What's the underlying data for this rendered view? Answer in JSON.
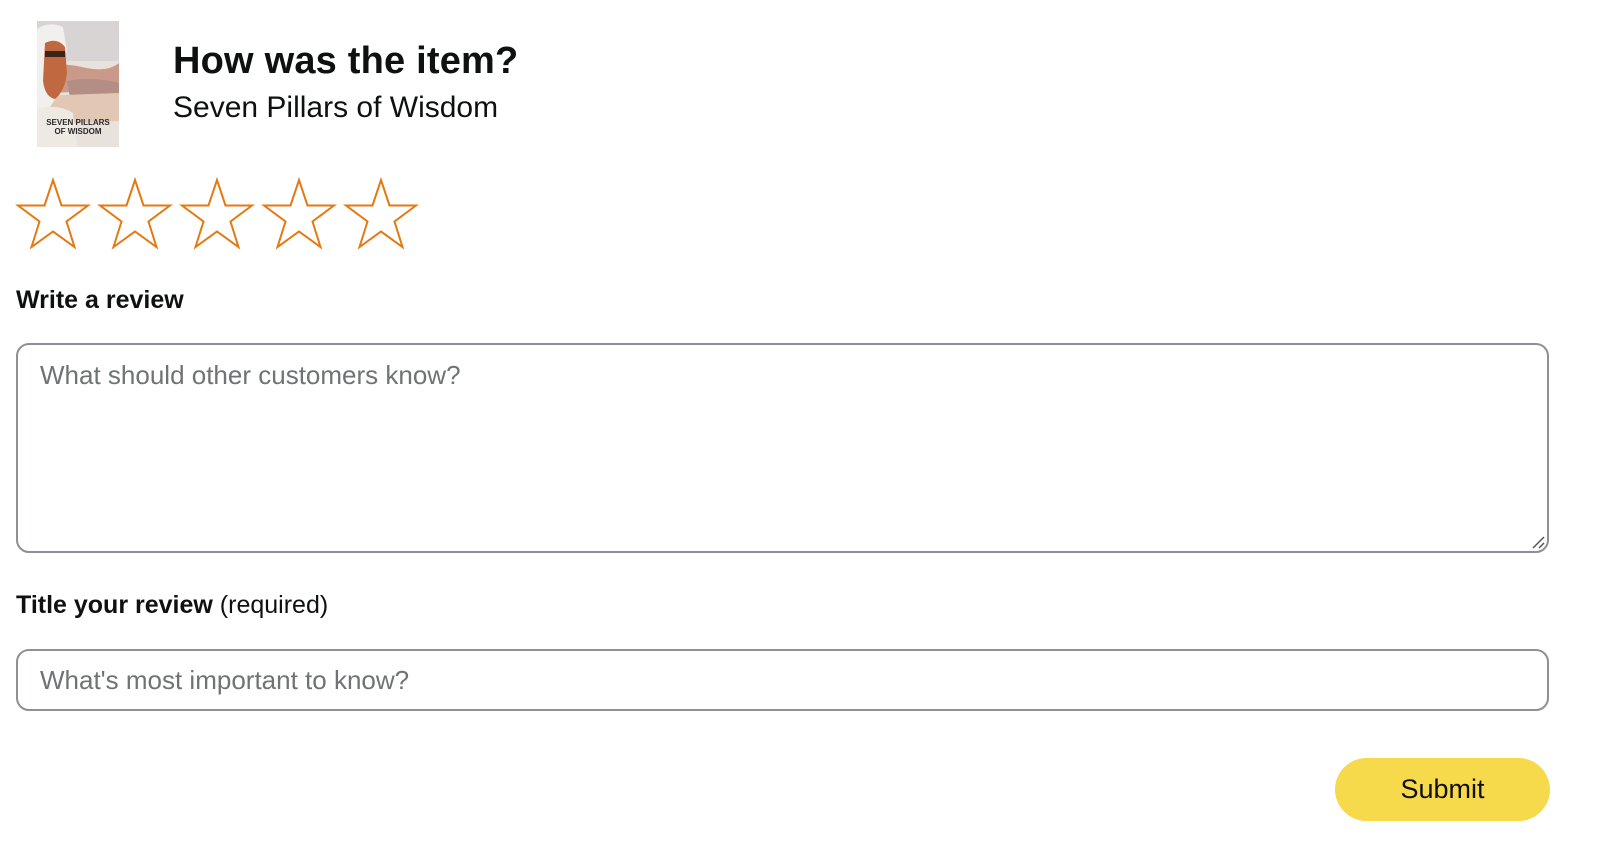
{
  "header": {
    "title": "How was the item?",
    "product_name": "Seven Pillars of Wisdom",
    "cover_title_line1": "SEVEN PILLARS",
    "cover_title_line2": "OF WISDOM"
  },
  "rating": {
    "max_stars": 5,
    "selected": 0,
    "star_color": "#e47911",
    "star_icon": "star-outline-icon"
  },
  "review": {
    "label": "Write a review",
    "placeholder": "What should other customers know?",
    "value": ""
  },
  "title_field": {
    "label": "Title your review",
    "note": "(required)",
    "placeholder": "What's most important to know?",
    "value": ""
  },
  "submit": {
    "label": "Submit",
    "color": "#f7d94c"
  }
}
